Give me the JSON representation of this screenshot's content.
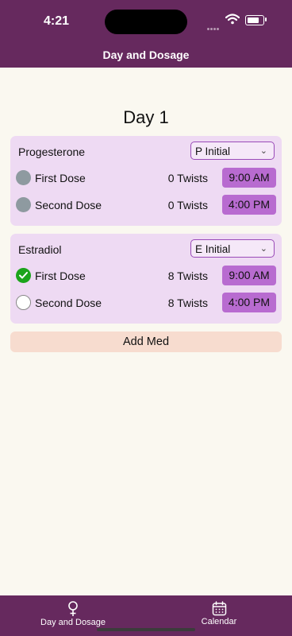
{
  "status_bar": {
    "time": "4:21"
  },
  "nav": {
    "title": "Day and Dosage"
  },
  "day": {
    "title": "Day 1"
  },
  "meds": [
    {
      "name": "Progesterone",
      "regimen": "P Initial",
      "doses": [
        {
          "label": "First Dose",
          "twists": "0 Twists",
          "time": "9:00 AM",
          "state": "disabled"
        },
        {
          "label": "Second Dose",
          "twists": "0 Twists",
          "time": "4:00 PM",
          "state": "disabled"
        }
      ]
    },
    {
      "name": "Estradiol",
      "regimen": "E Initial",
      "doses": [
        {
          "label": "First Dose",
          "twists": "8 Twists",
          "time": "9:00 AM",
          "state": "taken"
        },
        {
          "label": "Second Dose",
          "twists": "8 Twists",
          "time": "4:00 PM",
          "state": "not-taken"
        }
      ]
    }
  ],
  "add_med_label": "Add Med",
  "tabs": [
    {
      "label": "Day and Dosage",
      "icon": "venus-icon"
    },
    {
      "label": "Calendar",
      "icon": "calendar-icon"
    }
  ],
  "colors": {
    "brand": "#66295E",
    "card": "#EEDAF3",
    "time_button": "#B86BD0",
    "add_button": "#F7DCCF",
    "taken": "#1BA41B"
  }
}
